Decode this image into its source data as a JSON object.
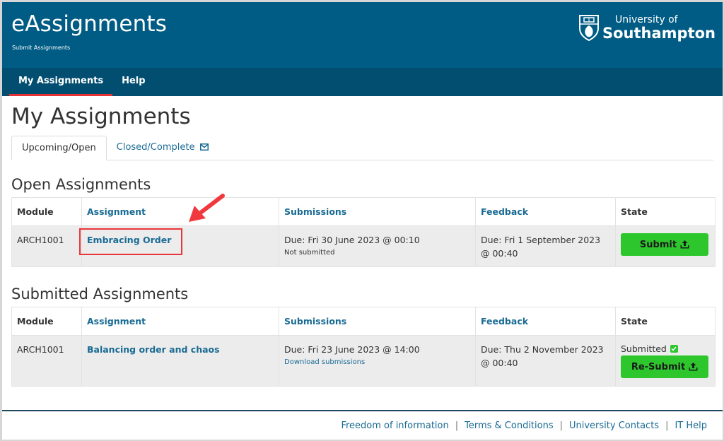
{
  "header": {
    "app_title": "eAssignments",
    "app_subtitle": "Submit Assignments",
    "logo_line1": "University of",
    "logo_line2": "Southampton"
  },
  "nav": {
    "items": [
      {
        "label": "My Assignments",
        "active": true
      },
      {
        "label": "Help",
        "active": false
      }
    ]
  },
  "page": {
    "title": "My Assignments",
    "tabs": [
      {
        "label": "Upcoming/Open",
        "active": true
      },
      {
        "label": "Closed/Complete",
        "icon": "envelope-icon",
        "active": false
      }
    ]
  },
  "open_assignments": {
    "title": "Open Assignments",
    "columns": [
      "Module",
      "Assignment",
      "Submissions",
      "Feedback",
      "State"
    ],
    "rows": [
      {
        "module": "ARCH1001",
        "assignment": "Embracing Order",
        "submission_due": "Due: Fri 30 June 2023 @ 00:10",
        "submission_status": "Not submitted",
        "feedback_due": "Due: Fri 1 September 2023 @ 00:40",
        "action_label": "Submit"
      }
    ]
  },
  "submitted_assignments": {
    "title": "Submitted Assignments",
    "columns": [
      "Module",
      "Assignment",
      "Submissions",
      "Feedback",
      "State"
    ],
    "rows": [
      {
        "module": "ARCH1001",
        "assignment": "Balancing order and chaos",
        "submission_due": "Due: Fri 23 June 2023 @ 14:00",
        "submission_link": "Download submissions",
        "feedback_due": "Due: Thu 2 November 2023 @ 00:40",
        "state": "Submitted",
        "action_label": "Re-Submit"
      }
    ]
  },
  "footer": {
    "links": [
      "Freedom of information",
      "Terms & Conditions",
      "University Contacts",
      "IT Help"
    ]
  },
  "colors": {
    "header_bg": "#005c84",
    "nav_bg": "#024e70",
    "accent_red": "#e63232",
    "link_blue": "#1a6b94",
    "button_green": "#2dc72d"
  }
}
